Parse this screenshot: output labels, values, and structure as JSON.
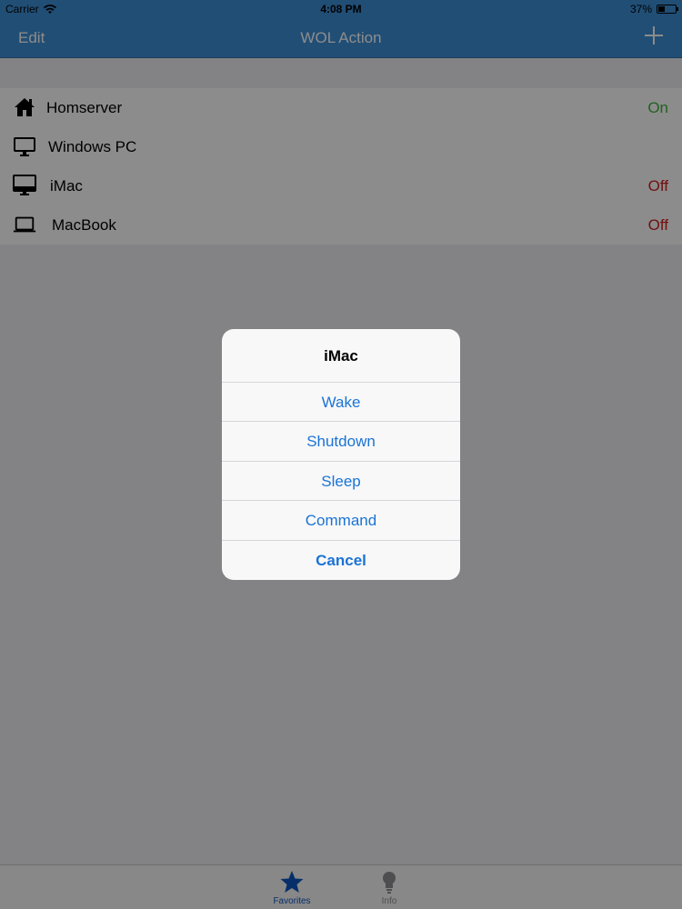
{
  "status_bar": {
    "carrier": "Carrier",
    "time": "4:08 PM",
    "battery": "37%",
    "battery_level": 0.37
  },
  "nav": {
    "edit_label": "Edit",
    "title": "WOL Action",
    "add_icon": "plus-icon"
  },
  "devices": [
    {
      "name": "Homserver",
      "icon": "home-icon",
      "status": "On",
      "status_color": "#3eb33a"
    },
    {
      "name": "Windows PC",
      "icon": "monitor-icon",
      "status": "",
      "status_color": ""
    },
    {
      "name": "iMac",
      "icon": "imac-icon",
      "status": "Off",
      "status_color": "#cc1f1f"
    },
    {
      "name": "MacBook",
      "icon": "laptop-icon",
      "status": "Off",
      "status_color": "#cc1f1f"
    }
  ],
  "alert": {
    "title": "iMac",
    "actions": [
      "Wake",
      "Shutdown",
      "Sleep",
      "Command"
    ],
    "cancel_label": "Cancel"
  },
  "tabbar": {
    "tabs": [
      {
        "label": "Favorites",
        "icon": "star-icon",
        "selected": true
      },
      {
        "label": "Info",
        "icon": "lightbulb-icon",
        "selected": false
      }
    ]
  },
  "colors": {
    "nav_background": "#3d8fd6",
    "tint": "#1a73d6",
    "on": "#3eb33a",
    "off": "#cc1f1f"
  }
}
